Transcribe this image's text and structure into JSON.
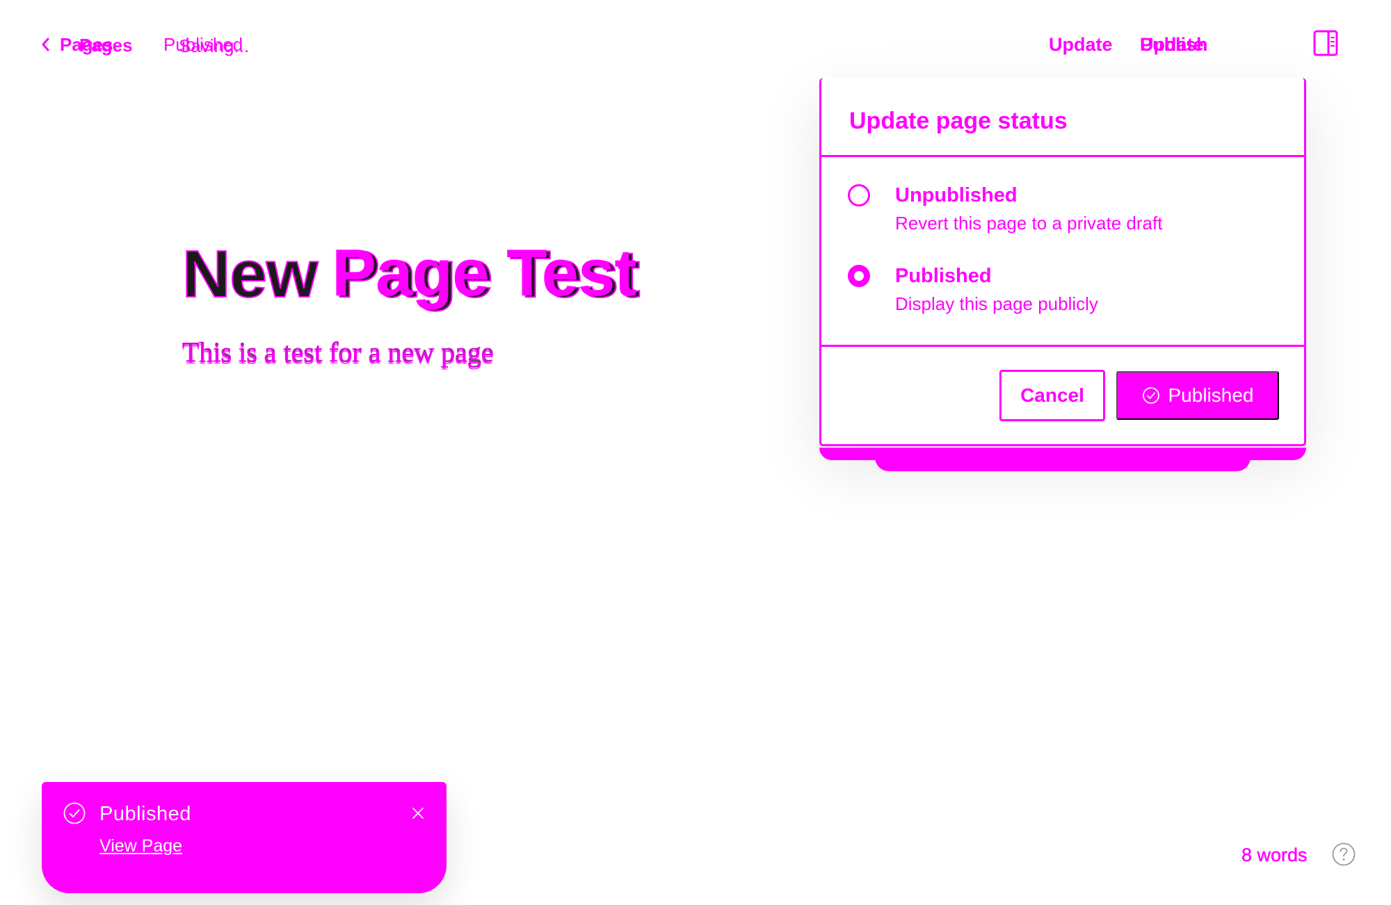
{
  "topbar": {
    "back_label": "Pages",
    "back_label_ghost": "Pages",
    "status_text": "Published",
    "status_text_ghost": "Saving...",
    "update_label": "Update",
    "publish_menu_label": "Update",
    "publish_menu_ghost": "Publish",
    "settings_icon": "sidebar-toggle-icon",
    "back_icon": "chevron-left-icon"
  },
  "editor": {
    "title": "New Page Test",
    "title_ghost": "Page Test",
    "excerpt": "This is a test for a new page"
  },
  "status_popover": {
    "title": "Update page status",
    "options": [
      {
        "label": "Unpublished",
        "description": "Revert this page to a private draft",
        "selected": false
      },
      {
        "label": "Published",
        "description": "Display this page publicly",
        "selected": true
      }
    ],
    "cancel_label": "Cancel",
    "confirm_label": "Published",
    "confirm_icon": "check-circle-icon"
  },
  "toast": {
    "title": "Published",
    "link_label": "View Page",
    "icon": "check-circle-icon",
    "close_icon": "close-icon"
  },
  "footer": {
    "word_count": "8 words",
    "help_icon": "question-circle-icon"
  },
  "colors": {
    "accent": "#ff00ff",
    "background": "#ffffff",
    "title_dark": "#1a1a1a"
  }
}
